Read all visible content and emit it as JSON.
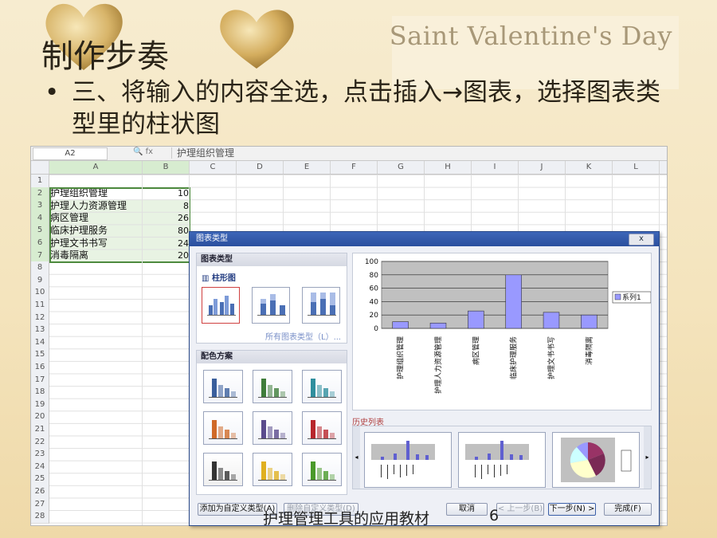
{
  "slide": {
    "title": "制作步奏",
    "brand_text": "Saint Valentine's Day",
    "bullet_mark": "•",
    "bullet_text": "三、将输入的内容全选，点击插入→图表，选择图表类型里的柱状图",
    "footer": "护理管理工具的应用教材",
    "page_number": "6"
  },
  "sheet": {
    "name_box": "A2",
    "fx_icons": "🔍 fx",
    "formula": "护理组织管理",
    "columns": [
      "A",
      "B",
      "C",
      "D",
      "E",
      "F",
      "G",
      "H",
      "I",
      "J",
      "K",
      "L"
    ],
    "row_numbers": [
      "1",
      "2",
      "3",
      "4",
      "5",
      "6",
      "7",
      "8",
      "9",
      "10",
      "11",
      "12",
      "13",
      "14",
      "15",
      "16",
      "17",
      "18",
      "19",
      "20",
      "21",
      "22",
      "23",
      "24",
      "25",
      "26",
      "27",
      "28"
    ],
    "rows": [
      {
        "a": "护理组织管理",
        "b": "10"
      },
      {
        "a": "护理人力资源管理",
        "b": "8"
      },
      {
        "a": "病区管理",
        "b": "26"
      },
      {
        "a": "临床护理服务",
        "b": "80"
      },
      {
        "a": "护理文书书写",
        "b": "24"
      },
      {
        "a": "消毒隔离",
        "b": "20"
      }
    ]
  },
  "dialog": {
    "title": "图表类型",
    "close": "x",
    "chart_type_header": "图表类型",
    "chart_tab": "柱形图",
    "all_types_link": "所有图表类型（L）...",
    "color_header": "配色方案",
    "history_label": "历史列表",
    "buttons": {
      "add_custom": "添加为自定义类型(A)",
      "delete_custom": "删除自定义类型(D)",
      "cancel": "取消",
      "prev": "< 上一步(B)",
      "next": "下一步(N) >",
      "finish": "完成(F)"
    },
    "scheme_colors": [
      "#3a5f9c",
      "#3f7d3a",
      "#2f8f9e",
      "#d06a28",
      "#5a4a8c",
      "#b8262c",
      "#333333",
      "#e0b020",
      "#4a9a2a"
    ]
  },
  "chart_data": {
    "type": "bar",
    "categories": [
      "护理组织管理",
      "护理人力资源管理",
      "病区管理",
      "临床护理服务",
      "护理文书书写",
      "消毒隔离"
    ],
    "series": [
      {
        "name": "系列1",
        "values": [
          10,
          8,
          26,
          80,
          24,
          20
        ]
      }
    ],
    "ylim": [
      0,
      100
    ],
    "yticks": [
      "0",
      "20",
      "40",
      "60",
      "80",
      "100"
    ],
    "grid": true,
    "legend": "right",
    "bar_color": "#9999ff",
    "plot_bg": "#c0c0c0"
  }
}
